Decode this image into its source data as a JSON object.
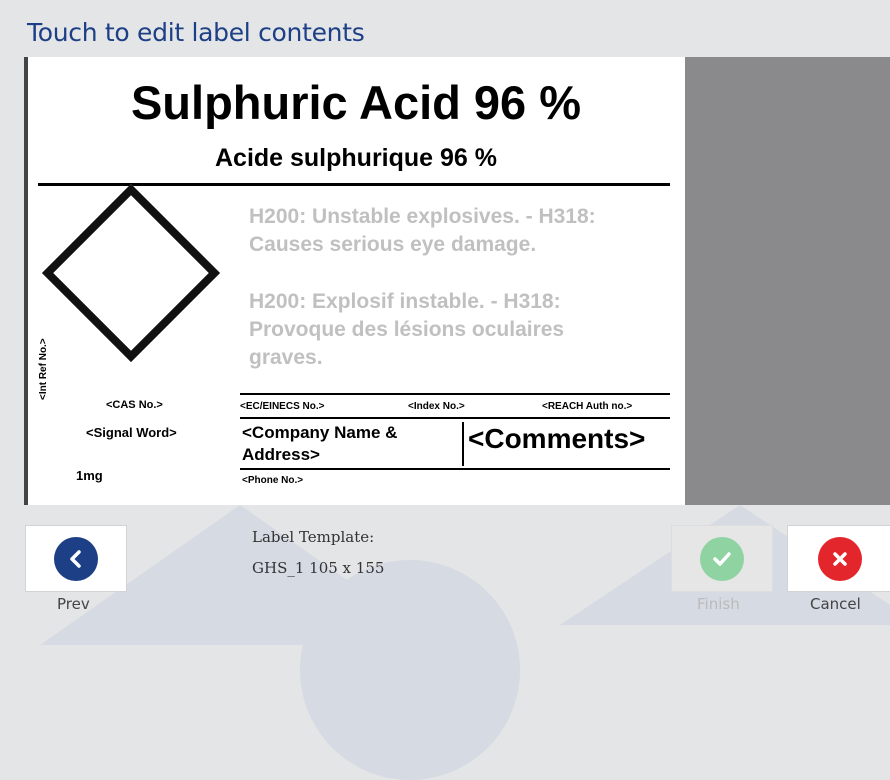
{
  "header": {
    "title": "Touch to edit label contents"
  },
  "label": {
    "title": "Sulphuric Acid 96 %",
    "subtitle": "Acide sulphurique 96 %",
    "hazard_en_line1": "H200: Unstable explosives. - H318:",
    "hazard_en_line2": "Causes serious eye damage.",
    "hazard_fr_line1": "H200: Explosif instable. - H318:",
    "hazard_fr_line2": "Provoque des lésions oculaires",
    "hazard_fr_line3": "graves.",
    "int_ref": "<Int Ref No.>",
    "cas_no": "<CAS No.>",
    "signal_word": "<Signal Word>",
    "ec_einecs": "<EC/EINECS No.>",
    "index_no": "<Index No.>",
    "reach_auth": "<REACH Auth no.>",
    "company_line1": "<Company Name &",
    "company_line2": "Address>",
    "comments": "<Comments>",
    "quantity": "1mg",
    "phone": "<Phone No.>"
  },
  "template": {
    "heading": "Label Template:",
    "name": "GHS_1 105 x 155"
  },
  "buttons": {
    "prev": {
      "label": "Prev",
      "icon": "chevron-left-icon",
      "color": "#1d3f86"
    },
    "finish": {
      "label": "Finish",
      "icon": "check-icon",
      "color": "#5fbf78"
    },
    "cancel": {
      "label": "Cancel",
      "icon": "close-icon",
      "color": "#e3262b"
    }
  }
}
